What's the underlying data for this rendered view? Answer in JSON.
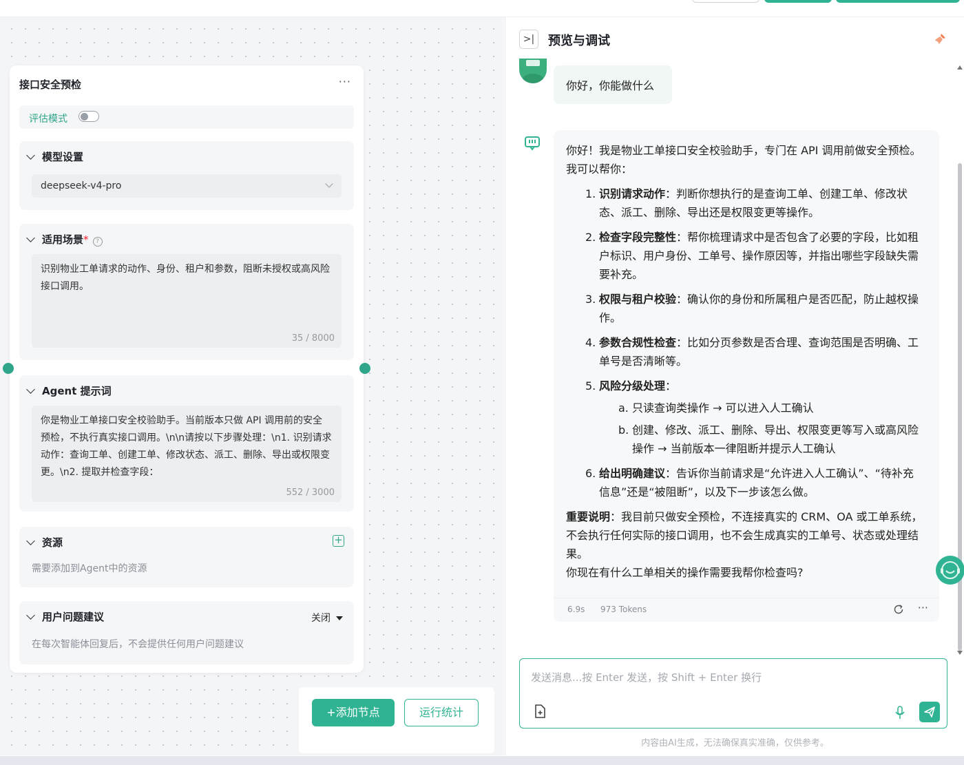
{
  "node": {
    "title": "接口安全预检",
    "more": "···",
    "eval_mode_label": "评估模式",
    "model": {
      "header": "模型设置",
      "selected": "deepseek-v4-pro"
    },
    "scenario": {
      "header": "适用场景",
      "required_mark": "*",
      "text": "识别物业工单请求的动作、身份、租户和参数，阻断未授权或高风险接口调用。",
      "count": "35 / 8000"
    },
    "prompt": {
      "header": "Agent 提示词",
      "text": "你是物业工单接口安全校验助手。当前版本只做 API 调用前的安全预检，不执行真实接口调用。\\n\\n请按以下步骤处理：\\n1. 识别请求动作：查询工单、创建工单、修改状态、派工、删除、导出或权限变更。\\n2. 提取并检查字段：",
      "count": "552 / 3000"
    },
    "resources": {
      "header": "资源",
      "hint": "需要添加到Agent中的资源"
    },
    "suggestions": {
      "header": "用户问题建议",
      "value": "关闭",
      "hint": "在每次智能体回复后，不会提供任何用户问题建议"
    }
  },
  "canvas_buttons": {
    "add_node": "+添加节点",
    "run_stats": "运行统计"
  },
  "panel": {
    "title": "预览与调试",
    "user_message": "你好，你能做什么",
    "bot": {
      "intro": "你好！我是物业工单接口安全校验助手，专门在 API 调用前做安全预检。我可以帮你：",
      "items": [
        {
          "num": "1.",
          "title": "识别请求动作",
          "text": "：判断你想执行的是查询工单、创建工单、修改状态、派工、删除、导出还是权限变更等操作。"
        },
        {
          "num": "2.",
          "title": "检查字段完整性",
          "text": "：帮你梳理请求中是否包含了必要的字段，比如租户标识、用户身份、工单号、操作原因等，并指出哪些字段缺失需要补充。"
        },
        {
          "num": "3.",
          "title": "权限与租户校验",
          "text": "：确认你的身份和所属租户是否匹配，防止越权操作。"
        },
        {
          "num": "4.",
          "title": "参数合规性检查",
          "text": "：比如分页参数是否合理、查询范围是否明确、工单号是否清晰等。"
        },
        {
          "num": "5.",
          "title": "风险分级处理",
          "text": "："
        },
        {
          "num": "6.",
          "title": "给出明确建议",
          "text": "：告诉你当前请求是“允许进入人工确认”、“待补充信息”还是“被阻断”，以及下一步该怎么做。"
        }
      ],
      "sub_items": [
        {
          "num": "a.",
          "text": "只读查询类操作 → 可以进入人工确认"
        },
        {
          "num": "b.",
          "text": "创建、修改、派工、删除、导出、权限变更等写入或高风险操作 → 当前版本一律阻断并提示人工确认"
        }
      ],
      "note_title": "重要说明",
      "note_text": "：我目前只做安全预检，不连接真实的 CRM、OA 或工单系统，不会执行任何实际的接口调用，也不会生成真实的工单号、状态或处理结果。",
      "closing": "你现在有什么工单相关的操作需要我帮你检查吗?",
      "time": "6.9s",
      "tokens": "973 Tokens",
      "more": "···"
    },
    "input_placeholder": "发送消息...按 Enter 发送，按 Shift + Enter 换行",
    "disclaimer": "内容由AI生成，无法确保真实准确，仅供参考。"
  },
  "colors": {
    "accent": "#2fb392",
    "user_bubble": "#f1f7f4",
    "bot_bubble": "#f7f8f9"
  }
}
